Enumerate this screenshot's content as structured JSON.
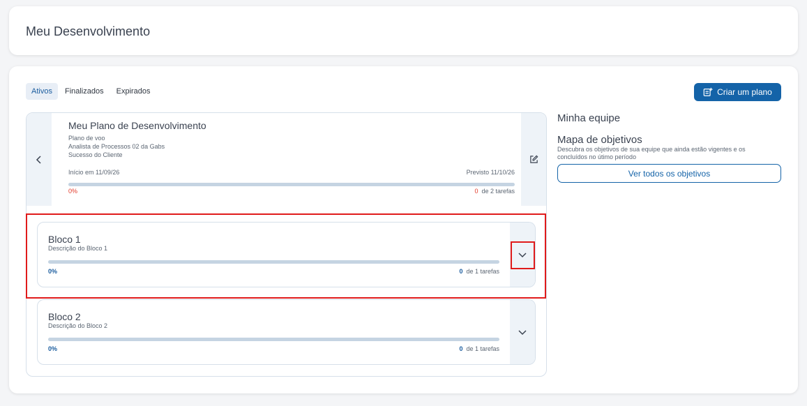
{
  "header": {
    "title": "Meu Desenvolvimento"
  },
  "tabs": [
    {
      "label": "Ativos"
    },
    {
      "label": "Finalizados"
    },
    {
      "label": "Expirados"
    }
  ],
  "create_button": {
    "label": "Criar um plano"
  },
  "plan": {
    "title": "Meu Plano de Desenvolvimento",
    "lines": [
      "Plano de voo",
      "Analista de Processos 02 da Gabs",
      "Sucesso do Cliente"
    ],
    "start": "Início em 11/09/26",
    "due": "Previsto 11/10/26",
    "progress_pct": "0%",
    "progress_value": 0,
    "done_count": "0",
    "total_text": "de 2 tarefas"
  },
  "blocks": [
    {
      "title": "Bloco 1",
      "description": "Descrição do Bloco 1",
      "progress_pct": "0%",
      "progress_value": 0,
      "done_count": "0",
      "total_text": "de 1 tarefas"
    },
    {
      "title": "Bloco 2",
      "description": "Descrição do Bloco 2",
      "progress_pct": "0%",
      "progress_value": 0,
      "done_count": "0",
      "total_text": "de 1 tarefas"
    }
  ],
  "side": {
    "team_title": "Minha equipe",
    "map_title": "Mapa de objetivos",
    "map_desc": "Descubra os objetivos de sua equipe que ainda estão vigentes e os concluídos no útimo período",
    "view_all_button": "Ver todos os objetivos"
  },
  "colors": {
    "accent": "#1463a8",
    "danger": "#e23a2a",
    "highlight": "#e01b1b"
  }
}
